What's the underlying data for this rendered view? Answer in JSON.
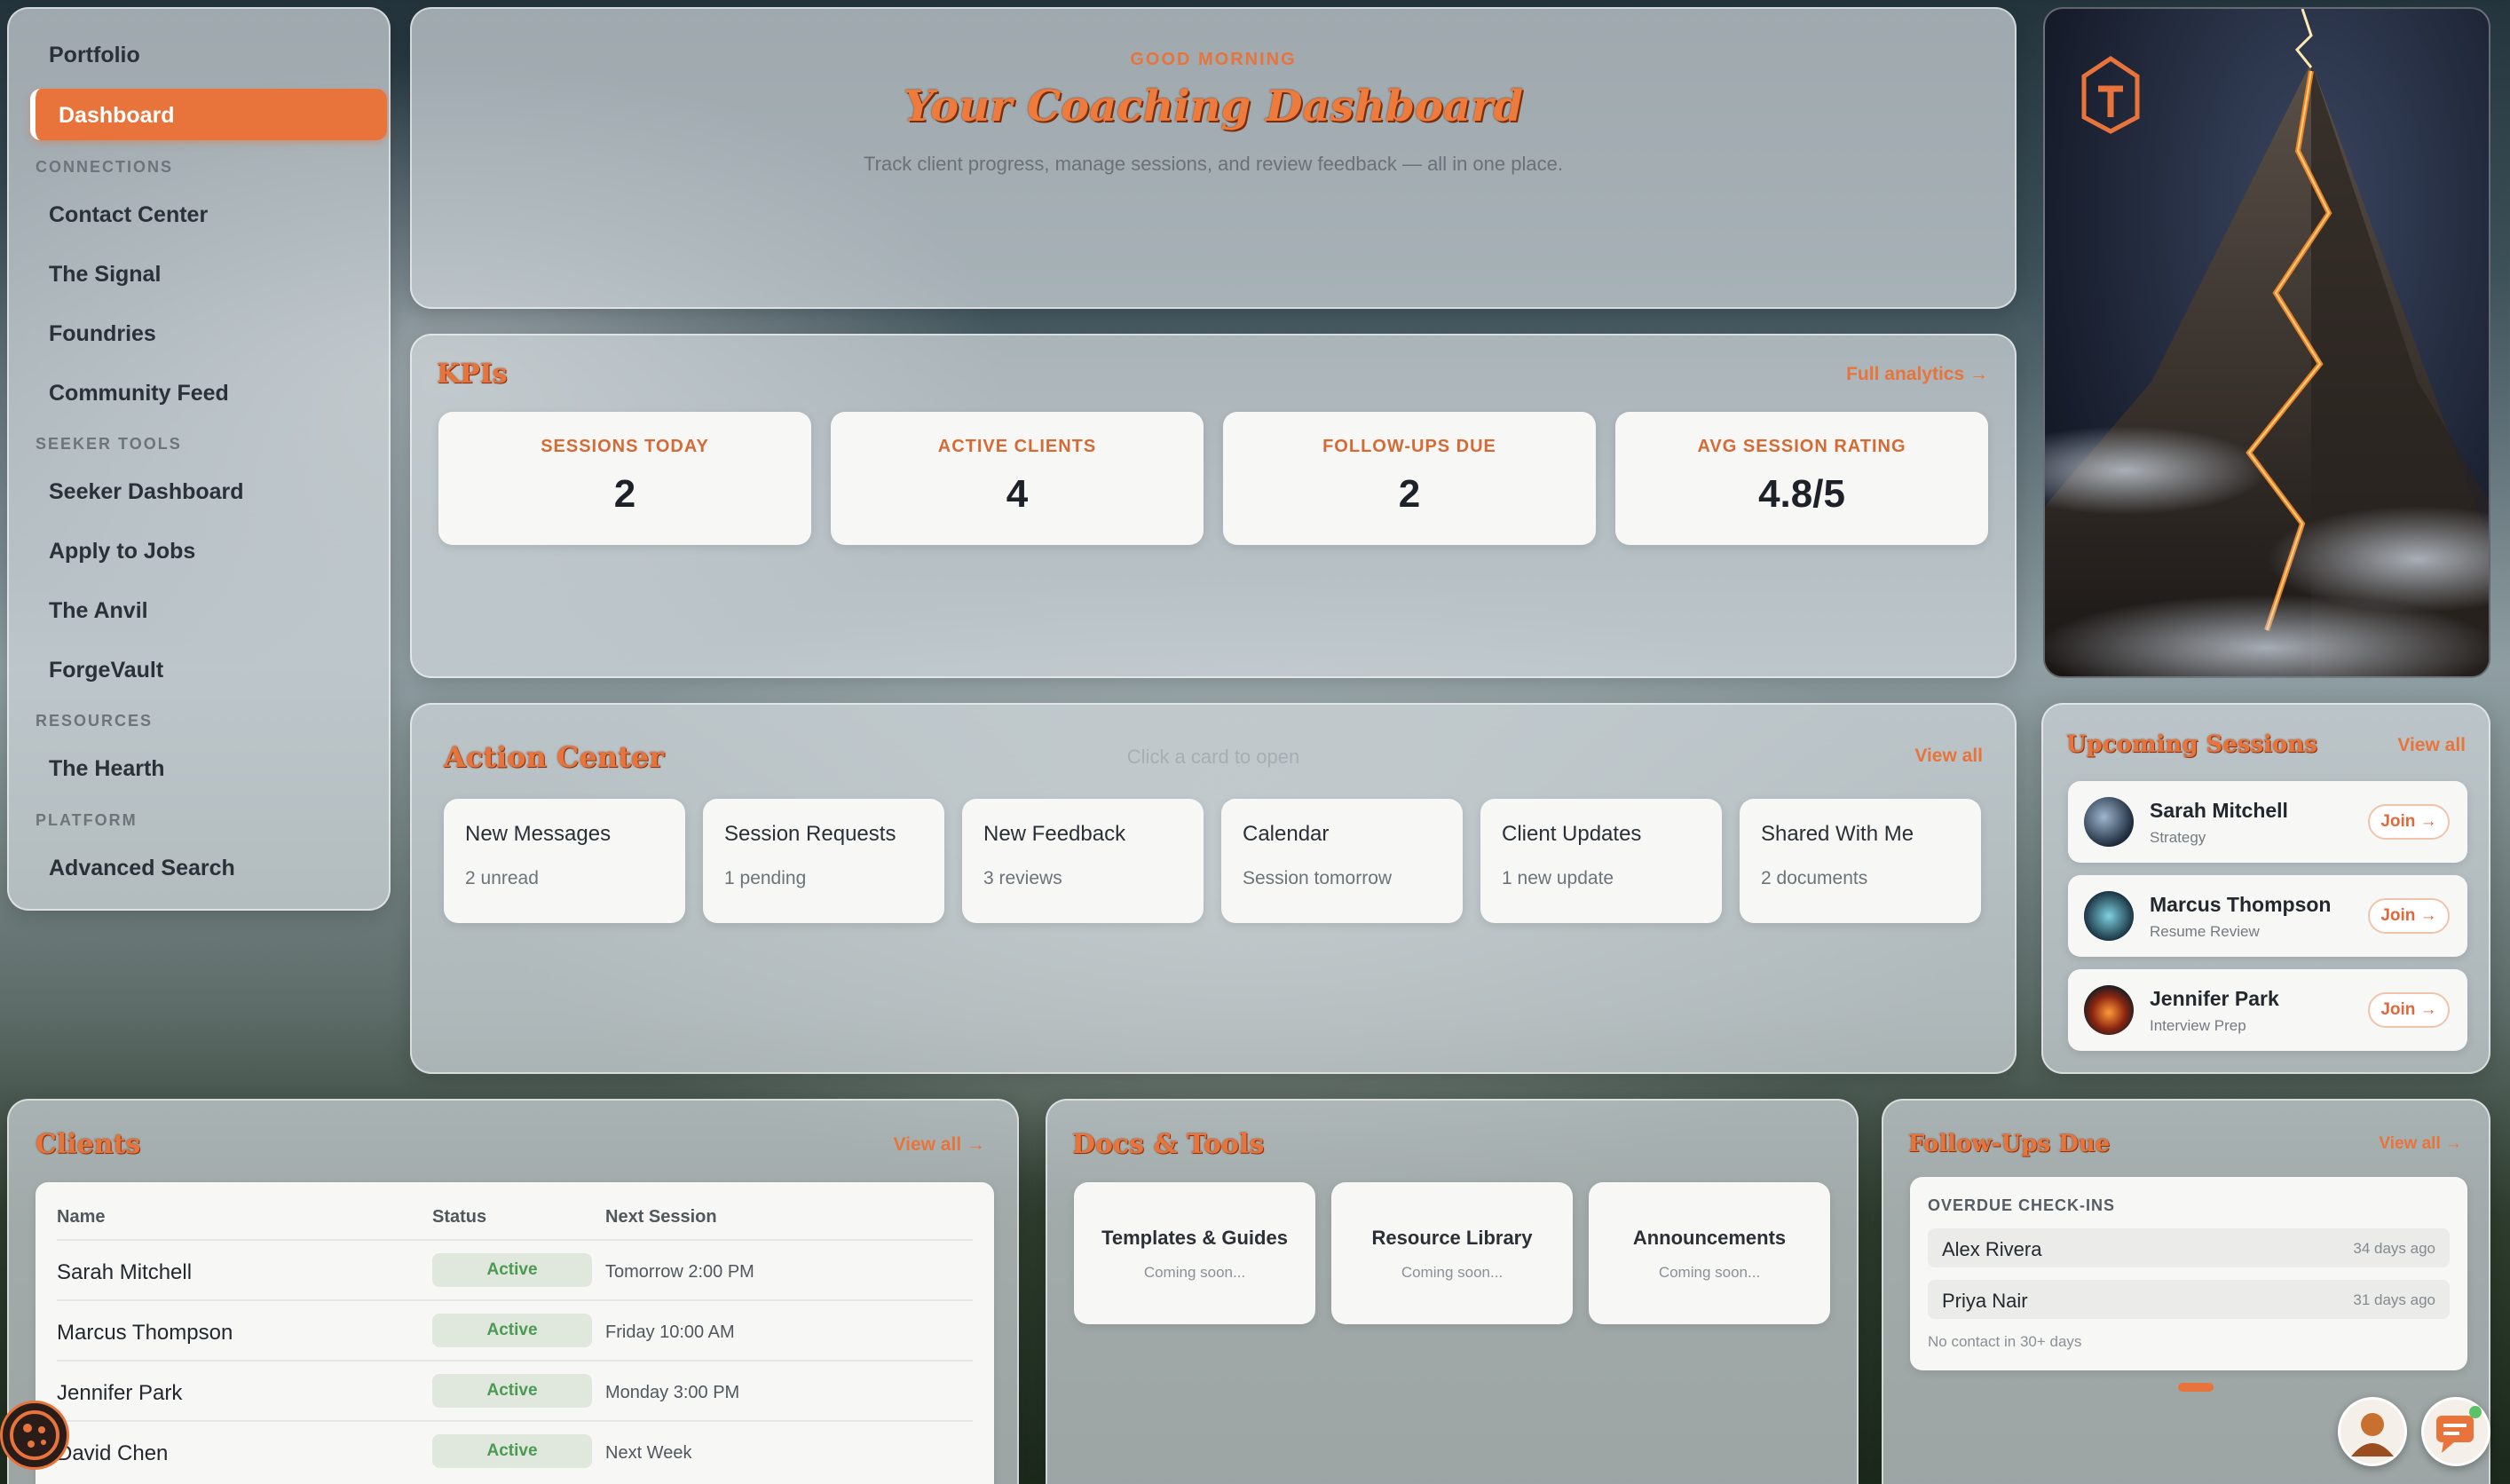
{
  "sidebar": {
    "portfolio": "Portfolio",
    "active": "Dashboard",
    "sections": [
      {
        "header": "CONNECTIONS",
        "items": [
          "Contact Center",
          "The Signal",
          "Foundries",
          "Community Feed"
        ]
      },
      {
        "header": "SEEKER TOOLS",
        "items": [
          "Seeker Dashboard",
          "Apply to Jobs",
          "The Anvil",
          "ForgeVault"
        ]
      },
      {
        "header": "RESOURCES",
        "items": [
          "The Hearth"
        ]
      },
      {
        "header": "PLATFORM",
        "items": [
          "Advanced Search"
        ]
      }
    ]
  },
  "header": {
    "greeting": "GOOD MORNING",
    "title": "Your Coaching Dashboard",
    "subtitle": "Track client progress, manage sessions, and review feedback — all in one place."
  },
  "kpis": {
    "title": "KPIs",
    "link": "Full analytics →",
    "items": [
      {
        "label": "SESSIONS TODAY",
        "value": "2"
      },
      {
        "label": "ACTIVE CLIENTS",
        "value": "4"
      },
      {
        "label": "FOLLOW-UPS DUE",
        "value": "2"
      },
      {
        "label": "AVG SESSION RATING",
        "value": "4.8/5"
      }
    ]
  },
  "action_center": {
    "title": "Action Center",
    "hint": "Click a card to open",
    "link": "View all",
    "cards": [
      {
        "title": "New Messages",
        "sub": "2 unread"
      },
      {
        "title": "Session Requests",
        "sub": "1 pending"
      },
      {
        "title": "New Feedback",
        "sub": "3 reviews"
      },
      {
        "title": "Calendar",
        "sub": "Session tomorrow"
      },
      {
        "title": "Client Updates",
        "sub": "1 new update"
      },
      {
        "title": "Shared With Me",
        "sub": "2 documents"
      }
    ]
  },
  "sessions": {
    "title": "Upcoming Sessions",
    "link": "View all",
    "join_label": "Join →",
    "items": [
      {
        "name": "Sarah Mitchell",
        "type": "Strategy"
      },
      {
        "name": "Marcus Thompson",
        "type": "Resume Review"
      },
      {
        "name": "Jennifer Park",
        "type": "Interview Prep"
      }
    ]
  },
  "clients": {
    "title": "Clients",
    "link": "View all →",
    "columns": [
      "Name",
      "Status",
      "Next Session"
    ],
    "rows": [
      {
        "name": "Sarah Mitchell",
        "status": "Active",
        "next": "Tomorrow 2:00 PM"
      },
      {
        "name": "Marcus Thompson",
        "status": "Active",
        "next": "Friday 10:00 AM"
      },
      {
        "name": "Jennifer Park",
        "status": "Active",
        "next": "Monday 3:00 PM"
      },
      {
        "name": "David Chen",
        "status": "Active",
        "next": "Next Week"
      }
    ]
  },
  "docs": {
    "title": "Docs & Tools",
    "items": [
      {
        "title": "Templates & Guides",
        "sub": "Coming soon..."
      },
      {
        "title": "Resource Library",
        "sub": "Coming soon..."
      },
      {
        "title": "Announcements",
        "sub": "Coming soon..."
      }
    ]
  },
  "followups": {
    "title": "Follow-Ups Due",
    "link": "View all →",
    "header": "OVERDUE CHECK-INS",
    "items": [
      {
        "name": "Alex Rivera",
        "ago": "34 days ago"
      },
      {
        "name": "Priya Nair",
        "ago": "31 days ago"
      }
    ],
    "note": "No contact in 30+ days"
  },
  "colors": {
    "accent": "#e8743b",
    "status_green": "#4c9a52",
    "panel": "#ced6da"
  },
  "icons": [
    "logo-icon",
    "mountain-hero-image",
    "cookie-icon",
    "coach-avatar-icon",
    "chat-icon"
  ]
}
